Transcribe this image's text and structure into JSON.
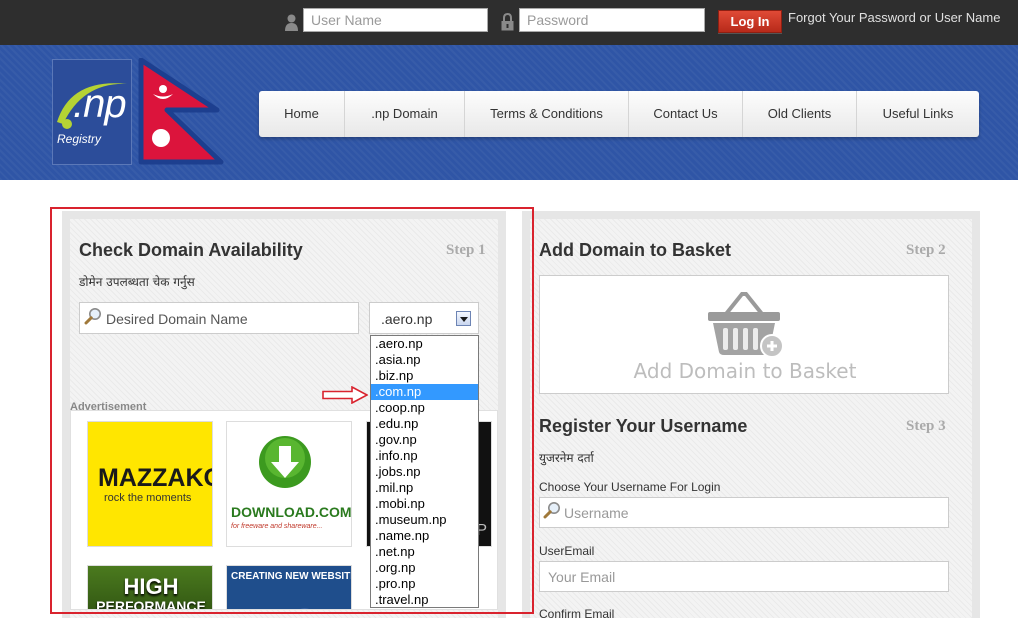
{
  "topbar": {
    "username_placeholder": "User Name",
    "password_placeholder": "Password",
    "login_label": "Log In",
    "forgot_label": "Forgot Your Password or User Name"
  },
  "logo": {
    "np_text": ".np",
    "registry_text": "Registry"
  },
  "nav": {
    "items": [
      {
        "label": "Home"
      },
      {
        "label": ".np Domain"
      },
      {
        "label": "Terms & Conditions"
      },
      {
        "label": "Contact Us"
      },
      {
        "label": "Old Clients"
      },
      {
        "label": "Useful Links"
      }
    ]
  },
  "check_domain": {
    "title": "Check Domain Availability",
    "step": "Step 1",
    "subtitle": "डोमेन उपलब्धता चेक गर्नुस",
    "input_placeholder": "Desired Domain Name",
    "selected_tld": ".aero.np",
    "tld_options": [
      ".aero.np",
      ".asia.np",
      ".biz.np",
      ".com.np",
      ".coop.np",
      ".edu.np",
      ".gov.np",
      ".info.np",
      ".jobs.np",
      ".mil.np",
      ".mobi.np",
      ".museum.np",
      ".name.np",
      ".net.np",
      ".org.np",
      ".pro.np",
      ".travel.np"
    ],
    "highlighted_option": ".com.np"
  },
  "ads": {
    "label": "Advertisement",
    "mazzako_title": "MAZZAKO",
    "mazzako_tagline": "rock the moments",
    "download_title": "DOWNLOAD.COM.NP",
    "download_tagline": "for freeware and shareware...",
    "dark_letter": "P",
    "high_title": "HIGH",
    "high_sub": "PERFORMANCE",
    "creating_title": "CREATING NEW WEBSITE ?"
  },
  "basket": {
    "title": "Add Domain to Basket",
    "step": "Step 2",
    "box_label": "Add Domain to Basket"
  },
  "register": {
    "title": "Register Your Username",
    "step": "Step 3",
    "subtitle": "युजरनेम दर्ता",
    "username_label": "Choose Your Username For Login",
    "username_placeholder": "Username",
    "email_label": "UserEmail",
    "email_placeholder": "Your Email",
    "confirm_label": "Confirm Email"
  },
  "colors": {
    "header_blue": "#2f55a6",
    "topbar_dark": "#2e2e2e",
    "login_red": "#c9311f",
    "highlight_red": "#d9232e",
    "selected_option": "#3399ff"
  }
}
